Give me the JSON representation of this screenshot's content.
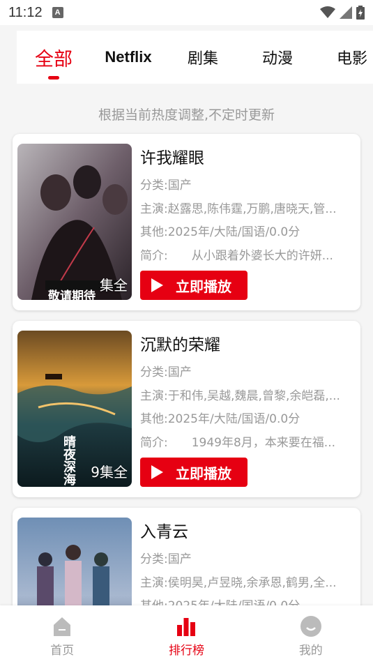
{
  "status_bar": {
    "time": "11:12",
    "notif_letter": "A"
  },
  "tabs": [
    {
      "label": "全部",
      "active": true
    },
    {
      "label": "Netflix",
      "active": false
    },
    {
      "label": "剧集",
      "active": false
    },
    {
      "label": "动漫",
      "active": false
    },
    {
      "label": "电影",
      "active": false
    }
  ],
  "hint": "根据当前热度调整,不定时更新",
  "items": [
    {
      "title": "许我耀眼",
      "category": "分类:国产",
      "cast": "主演:赵露思,陈伟霆,万鹏,唐晓天,管...",
      "other": "其他:2025年/大陆/国语/0.0分",
      "intro": "简介:　　从小跟着外婆长大的许妍...",
      "episodes": "集全",
      "play_label": "立即播放",
      "poster_text": "敬请期待"
    },
    {
      "title": "沉默的荣耀",
      "category": "分类:国产",
      "cast": "主演:于和伟,吴越,魏晨,曾黎,余皑磊,...",
      "other": "其他:2025年/大陆/国语/0.0分",
      "intro": "简介:　　1949年8月，本来要在福...",
      "episodes": "9集全",
      "play_label": "立即播放",
      "poster_text": "晴夜深海"
    },
    {
      "title": "入青云",
      "category": "分类:国产",
      "cast": "主演:侯明昊,卢昱晓,余承恩,鹤男,全...",
      "other": "其他:2025年/大陆/国语/0.0分",
      "intro": "",
      "episodes": "",
      "play_label": "立即播放",
      "poster_text": ""
    }
  ],
  "bottom_nav": [
    {
      "label": "首页",
      "icon": "home-icon",
      "active": false
    },
    {
      "label": "排行榜",
      "icon": "ranking-bar-icon",
      "active": true
    },
    {
      "label": "我的",
      "icon": "profile-smile-icon",
      "active": false
    }
  ],
  "colors": {
    "accent": "#e60012",
    "muted": "#999999",
    "background": "#f5f5f5"
  }
}
